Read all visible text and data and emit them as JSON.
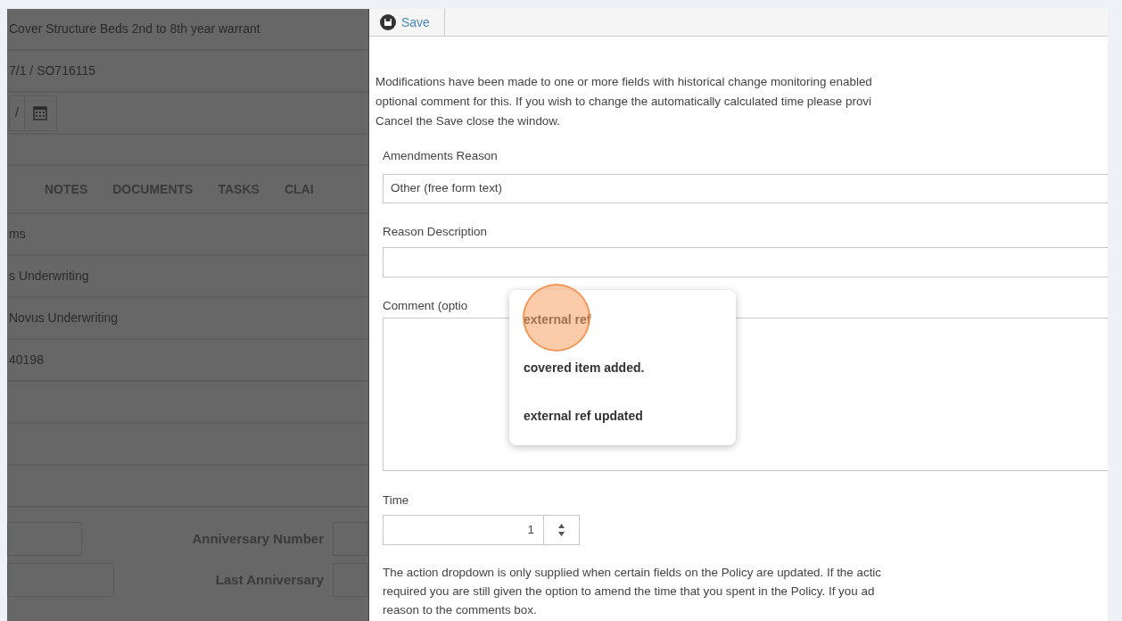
{
  "background_page": {
    "rows": [
      {
        "kind": "text",
        "text": "Cover Structure Beds 2nd to 8th year warrant"
      },
      {
        "kind": "text",
        "text": "7/1 / SO716115"
      },
      {
        "kind": "date",
        "text": "/"
      },
      {
        "kind": "gap"
      },
      {
        "kind": "tabs",
        "tabs": [
          "NOTES",
          "DOCUMENTS",
          "TASKS",
          "CLAI"
        ]
      },
      {
        "kind": "text",
        "text": "ms"
      },
      {
        "kind": "text",
        "text": "s Underwriting"
      },
      {
        "kind": "text",
        "text": "Novus Underwriting"
      },
      {
        "kind": "text",
        "text": "40198"
      },
      {
        "kind": "blank"
      },
      {
        "kind": "blank"
      },
      {
        "kind": "blank"
      }
    ],
    "labels": [
      "Anniversary Number",
      "Last Anniversary"
    ]
  },
  "dialog": {
    "toolbar": {
      "save_label": "Save"
    },
    "intro_lines": [
      "Modifications have been made to one or more fields with historical change monitoring enabled",
      "optional comment for this. If you wish to change the automatically calculated time please provi",
      "Cancel the Save close the window."
    ],
    "amendments_reason": {
      "label": "Amendments Reason",
      "value": "Other (free form text)"
    },
    "reason_description": {
      "label": "Reason Description"
    },
    "comment": {
      "label": "Comment (optio"
    },
    "suggestions": [
      {
        "text": "external ref",
        "highlighted": true
      },
      {
        "text": "covered item added.",
        "highlighted": false
      },
      {
        "text": "external ref updated",
        "highlighted": false
      }
    ],
    "time": {
      "label": "Time",
      "value": "1"
    },
    "footer_lines": [
      "The action dropdown is only supplied when certain fields on the Policy are updated. If the actic",
      "required you are still given the option to amend the time that you spent in the Policy. If you ad",
      "reason to the comments box."
    ]
  }
}
